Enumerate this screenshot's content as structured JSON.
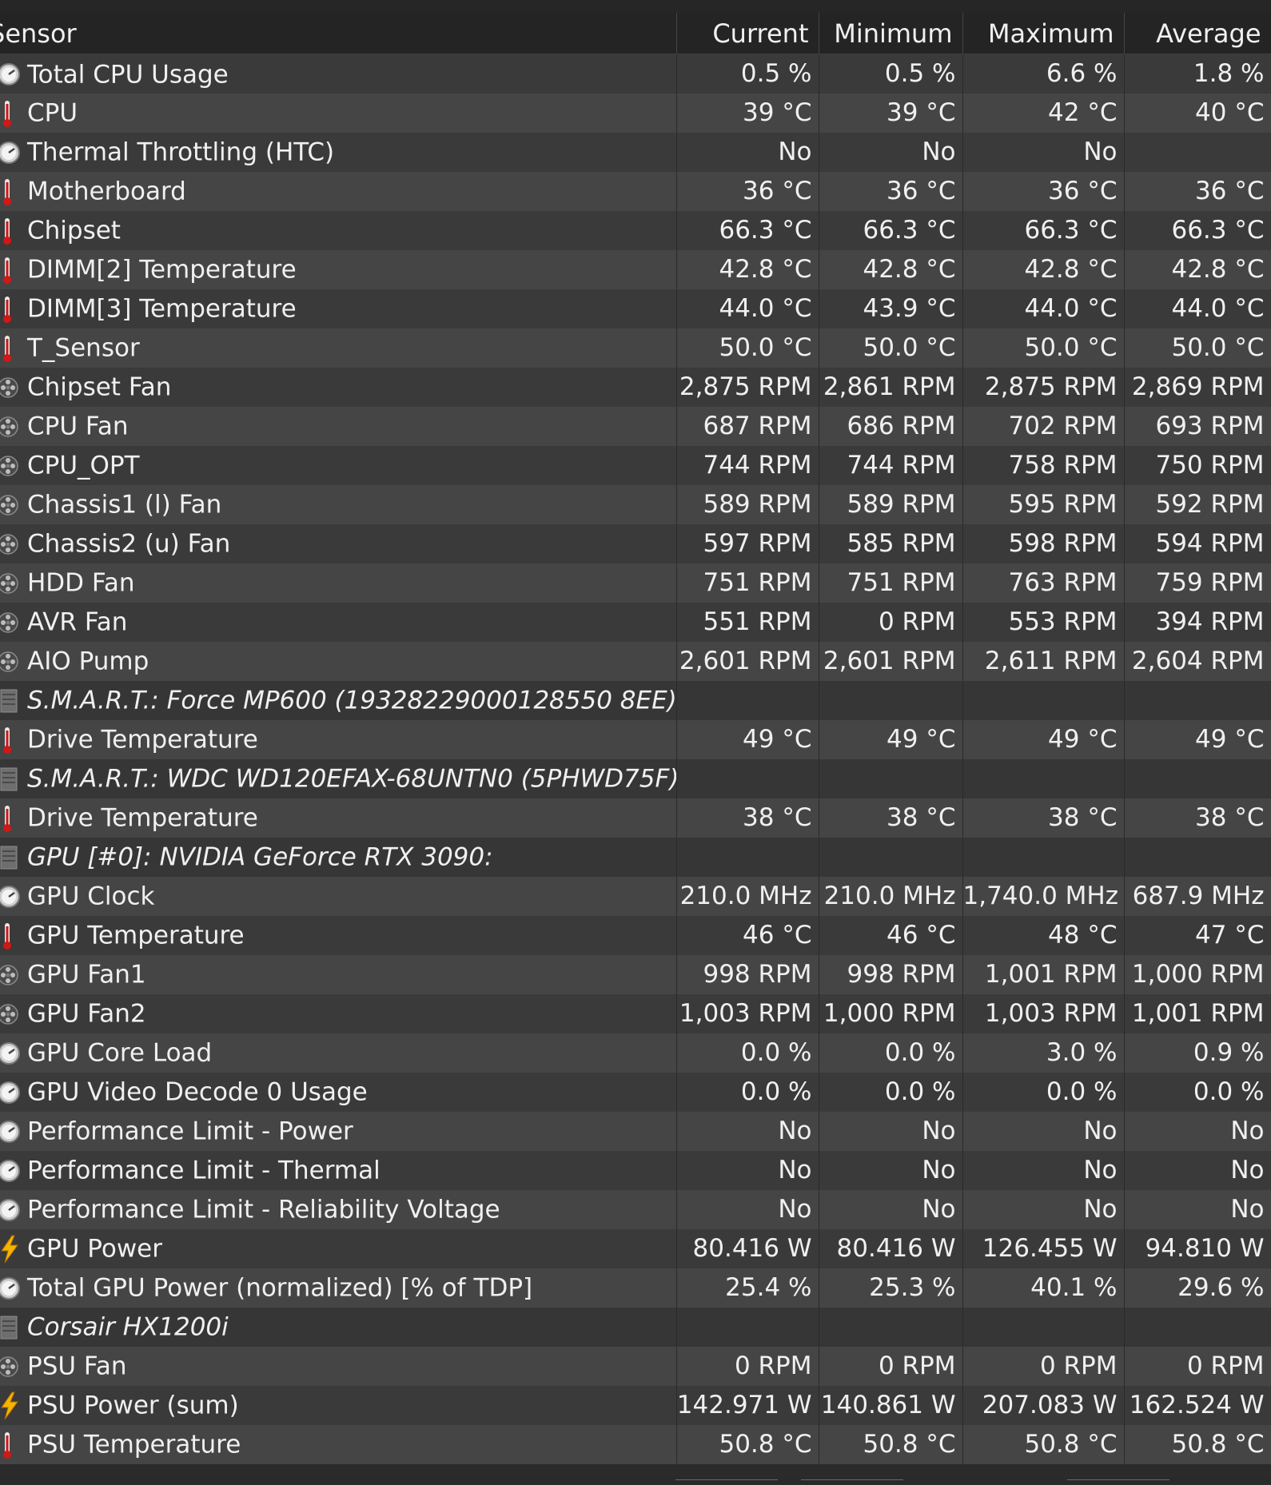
{
  "columns": [
    "Sensor",
    "Current",
    "Minimum",
    "Maximum",
    "Average"
  ],
  "rows": [
    {
      "icon": "gauge-icon",
      "name": "Total CPU Usage",
      "values": [
        "0.5 %",
        "0.5 %",
        "6.6 %",
        "1.8 %"
      ]
    },
    {
      "icon": "thermometer-icon",
      "name": "CPU",
      "values": [
        "39 °C",
        "39 °C",
        "42 °C",
        "40 °C"
      ]
    },
    {
      "icon": "gauge-icon",
      "name": "Thermal Throttling (HTC)",
      "values": [
        "No",
        "No",
        "No",
        ""
      ]
    },
    {
      "icon": "thermometer-icon",
      "name": "Motherboard",
      "values": [
        "36 °C",
        "36 °C",
        "36 °C",
        "36 °C"
      ]
    },
    {
      "icon": "thermometer-icon",
      "name": "Chipset",
      "values": [
        "66.3 °C",
        "66.3 °C",
        "66.3 °C",
        "66.3 °C"
      ]
    },
    {
      "icon": "thermometer-icon",
      "name": "DIMM[2] Temperature",
      "values": [
        "42.8 °C",
        "42.8 °C",
        "42.8 °C",
        "42.8 °C"
      ]
    },
    {
      "icon": "thermometer-icon",
      "name": "DIMM[3] Temperature",
      "values": [
        "44.0 °C",
        "43.9 °C",
        "44.0 °C",
        "44.0 °C"
      ]
    },
    {
      "icon": "thermometer-icon",
      "name": "T_Sensor",
      "values": [
        "50.0 °C",
        "50.0 °C",
        "50.0 °C",
        "50.0 °C"
      ]
    },
    {
      "icon": "fan-icon",
      "name": "Chipset Fan",
      "values": [
        "2,875 RPM",
        "2,861 RPM",
        "2,875 RPM",
        "2,869 RPM"
      ]
    },
    {
      "icon": "fan-icon",
      "name": "CPU Fan",
      "values": [
        "687 RPM",
        "686 RPM",
        "702 RPM",
        "693 RPM"
      ]
    },
    {
      "icon": "fan-icon",
      "name": "CPU_OPT",
      "values": [
        "744 RPM",
        "744 RPM",
        "758 RPM",
        "750 RPM"
      ]
    },
    {
      "icon": "fan-icon",
      "name": "Chassis1 (l) Fan",
      "values": [
        "589 RPM",
        "589 RPM",
        "595 RPM",
        "592 RPM"
      ]
    },
    {
      "icon": "fan-icon",
      "name": "Chassis2 (u) Fan",
      "values": [
        "597 RPM",
        "585 RPM",
        "598 RPM",
        "594 RPM"
      ]
    },
    {
      "icon": "fan-icon",
      "name": "HDD Fan",
      "values": [
        "751 RPM",
        "751 RPM",
        "763 RPM",
        "759 RPM"
      ]
    },
    {
      "icon": "fan-icon",
      "name": "AVR Fan",
      "values": [
        "551 RPM",
        "0 RPM",
        "553 RPM",
        "394 RPM"
      ]
    },
    {
      "icon": "fan-icon",
      "name": "AIO Pump",
      "values": [
        "2,601 RPM",
        "2,601 RPM",
        "2,611 RPM",
        "2,604 RPM"
      ]
    },
    {
      "icon": "device-icon",
      "group": true,
      "name": "S.M.A.R.T.: Force MP600 (19328229000128550 8EE)",
      "values": [
        "",
        "",
        "",
        ""
      ]
    },
    {
      "icon": "thermometer-icon",
      "name": "Drive Temperature",
      "values": [
        "49 °C",
        "49 °C",
        "49 °C",
        "49 °C"
      ]
    },
    {
      "icon": "device-icon",
      "group": true,
      "name": "S.M.A.R.T.: WDC WD120EFAX-68UNTN0 (5PHWD75F)",
      "values": [
        "",
        "",
        "",
        ""
      ]
    },
    {
      "icon": "thermometer-icon",
      "name": "Drive Temperature",
      "values": [
        "38 °C",
        "38 °C",
        "38 °C",
        "38 °C"
      ]
    },
    {
      "icon": "device-icon",
      "group": true,
      "name": "GPU [#0]: NVIDIA GeForce RTX 3090:",
      "values": [
        "",
        "",
        "",
        ""
      ]
    },
    {
      "icon": "gauge-icon",
      "name": "GPU Clock",
      "values": [
        "210.0 MHz",
        "210.0 MHz",
        "1,740.0 MHz",
        "687.9 MHz"
      ]
    },
    {
      "icon": "thermometer-icon",
      "name": "GPU Temperature",
      "values": [
        "46 °C",
        "46 °C",
        "48 °C",
        "47 °C"
      ]
    },
    {
      "icon": "fan-icon",
      "name": "GPU Fan1",
      "values": [
        "998 RPM",
        "998 RPM",
        "1,001 RPM",
        "1,000 RPM"
      ]
    },
    {
      "icon": "fan-icon",
      "name": "GPU Fan2",
      "values": [
        "1,003 RPM",
        "1,000 RPM",
        "1,003 RPM",
        "1,001 RPM"
      ]
    },
    {
      "icon": "gauge-icon",
      "name": "GPU Core Load",
      "values": [
        "0.0 %",
        "0.0 %",
        "3.0 %",
        "0.9 %"
      ]
    },
    {
      "icon": "gauge-icon",
      "name": "GPU Video Decode 0 Usage",
      "values": [
        "0.0 %",
        "0.0 %",
        "0.0 %",
        "0.0 %"
      ]
    },
    {
      "icon": "gauge-icon",
      "name": "Performance Limit - Power",
      "values": [
        "No",
        "No",
        "No",
        "No"
      ]
    },
    {
      "icon": "gauge-icon",
      "name": "Performance Limit - Thermal",
      "values": [
        "No",
        "No",
        "No",
        "No"
      ]
    },
    {
      "icon": "gauge-icon",
      "name": "Performance Limit - Reliability Voltage",
      "values": [
        "No",
        "No",
        "No",
        "No"
      ]
    },
    {
      "icon": "lightning-icon",
      "name": "GPU Power",
      "values": [
        "80.416 W",
        "80.416 W",
        "126.455 W",
        "94.810 W"
      ]
    },
    {
      "icon": "gauge-icon",
      "name": "Total GPU Power (normalized) [% of TDP]",
      "values": [
        "25.4 %",
        "25.3 %",
        "40.1 %",
        "29.6 %"
      ]
    },
    {
      "icon": "device-icon",
      "group": true,
      "name": "Corsair HX1200i",
      "values": [
        "",
        "",
        "",
        ""
      ]
    },
    {
      "icon": "fan-icon",
      "name": "PSU Fan",
      "values": [
        "0 RPM",
        "0 RPM",
        "0 RPM",
        "0 RPM"
      ]
    },
    {
      "icon": "lightning-icon",
      "name": "PSU Power (sum)",
      "values": [
        "142.971 W",
        "140.861 W",
        "207.083 W",
        "162.524 W"
      ]
    },
    {
      "icon": "thermometer-icon",
      "name": "PSU Temperature",
      "values": [
        "50.8 °C",
        "50.8 °C",
        "50.8 °C",
        "50.8 °C"
      ]
    }
  ]
}
